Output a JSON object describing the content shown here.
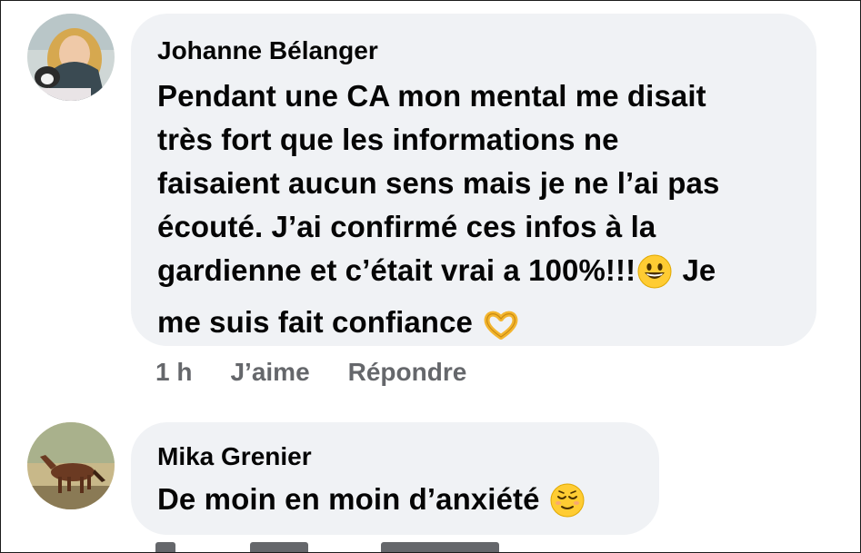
{
  "comments": [
    {
      "author": "Johanne Bélanger",
      "text_line1": "Pendant une CA mon mental me disait",
      "text_line2": "très fort que les informations ne",
      "text_line3": "faisaient aucun sens mais je ne l’ai pas",
      "text_line4": "écouté. J’ai confirmé ces infos à la",
      "text_line5a": "gardienne et c’était vrai a 100%!!!",
      "text_line5b": "Je",
      "text_line6": "me suis fait confiance",
      "time": "1 h",
      "like_label": "J’aime",
      "reply_label": "Répondre"
    },
    {
      "author": "Mika Grenier",
      "text": "De moin en moin d’anxiété"
    }
  ],
  "icons": {
    "grinning": "grinning-face-emoji",
    "heart_hands": "heart-hands-emoji",
    "relieved": "relieved-face-emoji"
  },
  "colors": {
    "bubble": "#f0f2f5",
    "meta_text": "#65676b",
    "text": "#050505"
  }
}
